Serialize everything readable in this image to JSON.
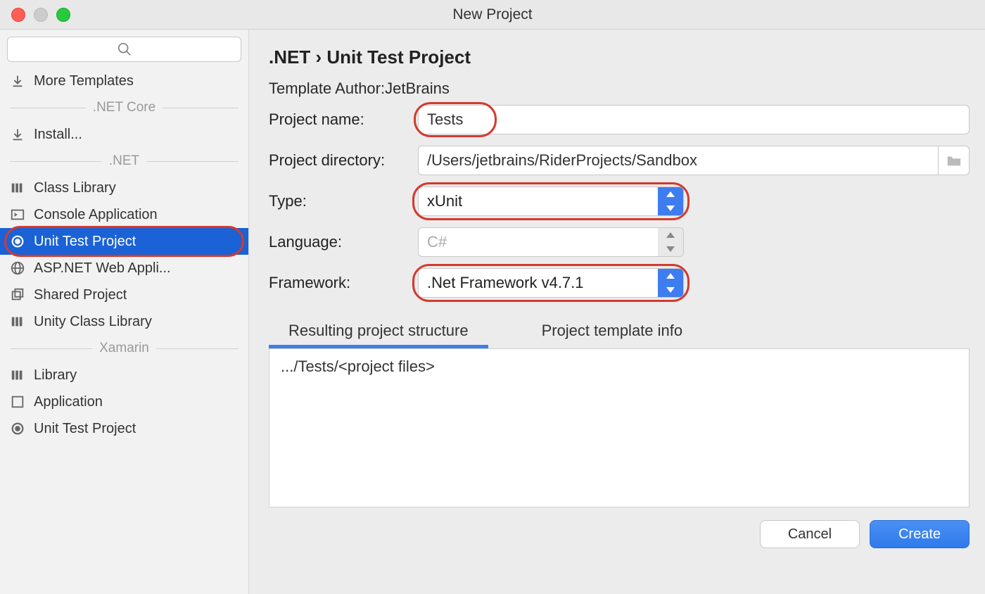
{
  "window": {
    "title": "New Project"
  },
  "sidebar": {
    "more_templates": "More Templates",
    "group_netcore": ".NET Core",
    "install": "Install...",
    "group_net": ".NET",
    "items_net": [
      "Class Library",
      "Console Application",
      "Unit Test Project",
      "ASP.NET Web Appli...",
      "Shared Project",
      "Unity Class Library"
    ],
    "group_xamarin": "Xamarin",
    "items_xamarin": [
      "Library",
      "Application",
      "Unit Test Project"
    ]
  },
  "main": {
    "breadcrumb": ".NET  ›  Unit Test Project",
    "author_label": "Template Author:",
    "author_value": "JetBrains",
    "project_name_label": "Project name:",
    "project_name_value": "Tests",
    "project_dir_label": "Project directory:",
    "project_dir_value": "/Users/jetbrains/RiderProjects/Sandbox",
    "type_label": "Type:",
    "type_value": "xUnit",
    "language_label": "Language:",
    "language_value": "C#",
    "framework_label": "Framework:",
    "framework_value": ".Net Framework v4.7.1",
    "tab_structure": "Resulting project structure",
    "tab_template_info": "Project template info",
    "structure_line": ".../Tests/<project files>"
  },
  "footer": {
    "cancel": "Cancel",
    "create": "Create"
  }
}
